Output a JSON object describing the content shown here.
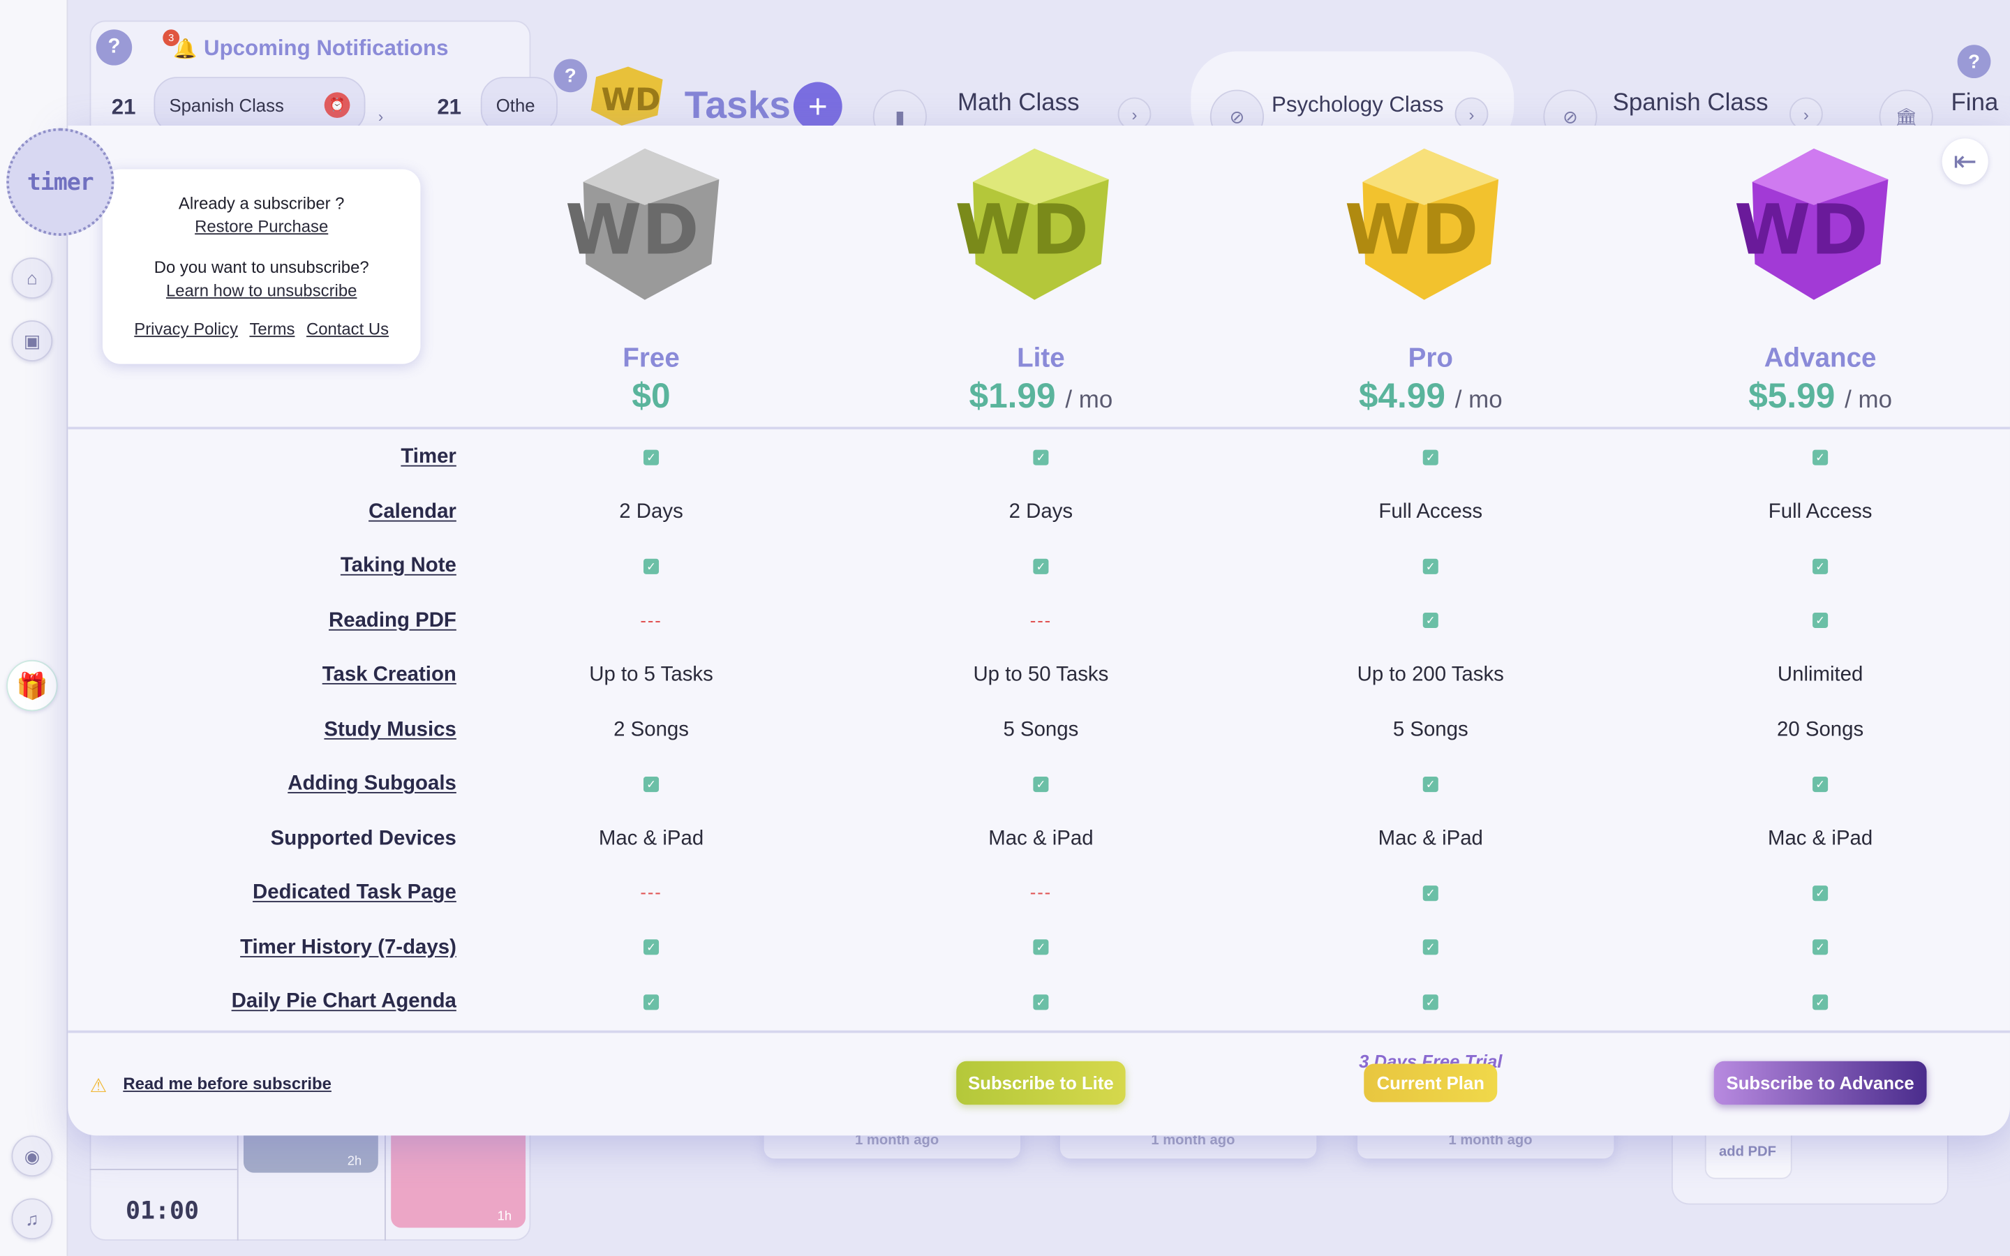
{
  "notifications": {
    "title": "Upcoming Notifications",
    "badge_count": "3",
    "help": "?",
    "day1": "21",
    "day2": "21",
    "item1": "Spanish Class",
    "item2": "Othe"
  },
  "tasks_header": {
    "help": "?",
    "title": "Tasks",
    "add": "+",
    "tabs": [
      {
        "label": "Math Class"
      },
      {
        "label": "Psychology Class"
      },
      {
        "label": "Spanish Class"
      },
      {
        "label": "Fina"
      }
    ],
    "help_right": "?"
  },
  "rail": {
    "timer": "timer"
  },
  "modal": {
    "info": {
      "line1": "Already a subscriber ?",
      "restore": "Restore Purchase",
      "line2": "Do you want to unsubscribe?",
      "learn": "Learn how to unsubscribe",
      "privacy": "Privacy Policy",
      "terms": "Terms",
      "contact": "Contact Us"
    },
    "plans": [
      {
        "name": "Free",
        "price": "$0",
        "per": "",
        "color": "#a9a9a9"
      },
      {
        "name": "Lite",
        "price": "$1.99",
        "per": "/ mo",
        "color": "#b5c83c"
      },
      {
        "name": "Pro",
        "price": "$4.99",
        "per": "/ mo",
        "color": "#f2c530"
      },
      {
        "name": "Advance",
        "price": "$5.99",
        "per": "/ mo",
        "color": "#a23ad6"
      }
    ],
    "features": [
      {
        "label": "Timer",
        "link": true,
        "values": [
          "check",
          "check",
          "check",
          "check"
        ]
      },
      {
        "label": "Calendar",
        "link": true,
        "values": [
          "2 Days",
          "2 Days",
          "Full Access",
          "Full Access"
        ]
      },
      {
        "label": "Taking Note",
        "link": true,
        "values": [
          "check",
          "check",
          "check",
          "check"
        ]
      },
      {
        "label": "Reading PDF",
        "link": true,
        "values": [
          "---",
          "---",
          "check",
          "check"
        ]
      },
      {
        "label": "Task Creation",
        "link": true,
        "values": [
          "Up to 5 Tasks",
          "Up to 50 Tasks",
          "Up to 200 Tasks",
          "Unlimited"
        ]
      },
      {
        "label": "Study Musics",
        "link": true,
        "values": [
          "2 Songs",
          "5 Songs",
          "5 Songs",
          "20 Songs"
        ]
      },
      {
        "label": "Adding Subgoals",
        "link": true,
        "values": [
          "check",
          "check",
          "check",
          "check"
        ]
      },
      {
        "label": "Supported Devices",
        "link": false,
        "values": [
          "Mac & iPad",
          "Mac & iPad",
          "Mac & iPad",
          "Mac & iPad"
        ]
      },
      {
        "label": "Dedicated Task Page",
        "link": true,
        "values": [
          "---",
          "---",
          "check",
          "check"
        ]
      },
      {
        "label": "Timer History (7-days)",
        "link": true,
        "values": [
          "check",
          "check",
          "check",
          "check"
        ]
      },
      {
        "label": "Daily Pie Chart Agenda",
        "link": true,
        "values": [
          "check",
          "check",
          "check",
          "check"
        ]
      }
    ],
    "footer": {
      "read_me": "Read me before subscribe",
      "subscribe_lite": "Subscribe to Lite",
      "trial": "3 Days Free Trial",
      "current_plan": "Current Plan",
      "subscribe_advance": "Subscribe to Advance"
    }
  },
  "background_bottom": {
    "bar1_label": "2h",
    "bar2_label": "1h",
    "time": "01:00",
    "card_label": "1 month ago",
    "add_pdf": "add PDF"
  }
}
